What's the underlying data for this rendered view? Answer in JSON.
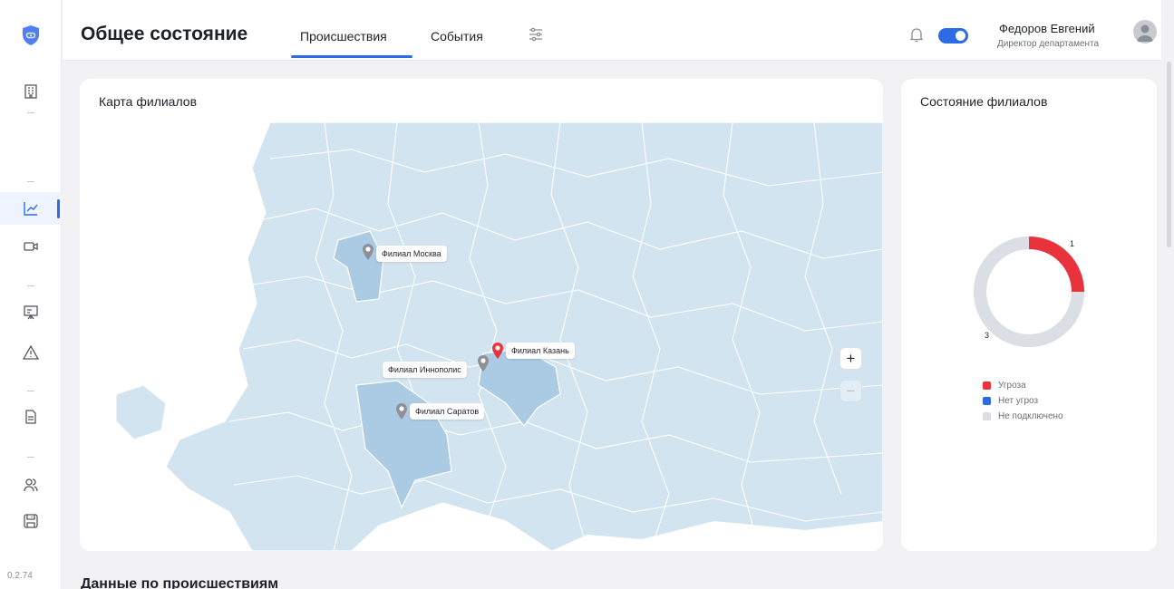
{
  "app": {
    "version": "0.2.74"
  },
  "sidebar": {
    "items": [
      {
        "name": "building",
        "icon": "building-icon"
      },
      {
        "name": "analytics",
        "icon": "chart-line-icon",
        "active": true
      },
      {
        "name": "cameras",
        "icon": "video-camera-icon"
      },
      {
        "name": "presentation",
        "icon": "presentation-board-icon"
      },
      {
        "name": "alerts",
        "icon": "warning-triangle-icon"
      },
      {
        "name": "documents",
        "icon": "document-icon"
      },
      {
        "name": "users",
        "icon": "users-icon"
      },
      {
        "name": "storage",
        "icon": "save-disk-icon"
      }
    ]
  },
  "header": {
    "title": "Общее состояние",
    "tabs": [
      {
        "label": "Происшествия",
        "active": true
      },
      {
        "label": "События",
        "active": false
      }
    ],
    "notifications_toggle_on": true,
    "user": {
      "name": "Федоров Евгений",
      "role": "Директор департамента"
    }
  },
  "map_card": {
    "title": "Карта филиалов",
    "branches": [
      {
        "label": "Филиал Москва",
        "status": "not_connected"
      },
      {
        "label": "Филиал Иннополис",
        "status": "not_connected"
      },
      {
        "label": "Филиал Казань",
        "status": "threat"
      },
      {
        "label": "Филиал Саратов",
        "status": "not_connected"
      }
    ],
    "zoom_in_label": "+",
    "zoom_out_label": "−"
  },
  "status_card": {
    "title": "Состояние филиалов",
    "threat_count": "1",
    "not_connected_count": "3",
    "legend": [
      {
        "label": "Угроза",
        "color": "#e8323c"
      },
      {
        "label": "Нет угроз",
        "color": "#2d6be4"
      },
      {
        "label": "Не подключено",
        "color": "#dcdee5"
      }
    ],
    "chart_data": {
      "type": "pie",
      "categories": [
        "Угроза",
        "Нет угроз",
        "Не подключено"
      ],
      "values": [
        1,
        0,
        3
      ]
    }
  },
  "section": {
    "title": "Данные по происшествиям"
  },
  "colors": {
    "accent": "#2d6be4",
    "threat": "#e8323c",
    "not_connected": "#dcdee5",
    "map_region": "#d3e4f1",
    "map_highlight": "#aacbe3",
    "map_border": "#ffffff"
  }
}
